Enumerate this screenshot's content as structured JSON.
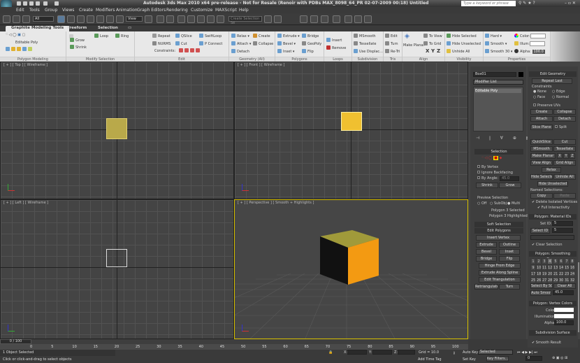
{
  "title": "Autodesk 3ds Max  2010 x64 pre-release - Not for Resale (Renoir with PDBs MAX_8098_64_PR 02-07-2009 00:18)   Untitled",
  "search_placeholder": "Type a keyword or phrase",
  "menu": [
    "Edit",
    "Tools",
    "Group",
    "Views",
    "Create",
    "Modifiers",
    "Animation",
    "Graph Editors",
    "Rendering",
    "Customize",
    "MAXScript",
    "Help"
  ],
  "toolbar": {
    "selection_filter": "All",
    "ref_coord": "View",
    "named_selection_placeholder": "Create Selection Se"
  },
  "ribbon": {
    "tabs": [
      "Graphite Modeling Tools",
      "Freeform",
      "Selection"
    ],
    "panels": {
      "polygon_modeling": {
        "title": "Polygon Modeling",
        "mode": "Editable Poly"
      },
      "modify_selection": {
        "title": "Modify Selection",
        "items": [
          "Grow",
          "Shrink",
          "Loop",
          "Ring"
        ]
      },
      "edit": {
        "title": "Edit",
        "items": [
          "Repeat",
          "QSlice",
          "SwiftLoop",
          "NURMS",
          "Cut",
          "P Connect"
        ],
        "constraints": "Constraints:"
      },
      "geometry": {
        "title": "Geometry (All)",
        "items": [
          "Relax",
          "Create",
          "Attach",
          "Collapse",
          "Detach"
        ]
      },
      "polygons": {
        "title": "Polygons",
        "items": [
          "Extrude",
          "Bridge",
          "Bevel",
          "GeoPoly",
          "Inset",
          "Flip"
        ]
      },
      "loops": {
        "title": "Loops",
        "items": [
          "Insert",
          "Remove"
        ]
      },
      "subdivision": {
        "title": "Subdivision",
        "items": [
          "MSmooth",
          "Tessellate",
          "Use Displac..."
        ]
      },
      "tris": {
        "title": "Tris",
        "items": [
          "Edit",
          "Turn",
          "Re-Tri"
        ]
      },
      "align": {
        "title": "Align",
        "items": [
          "Make Planar",
          "To View",
          "To Grid",
          "X",
          "Y",
          "Z"
        ]
      },
      "visibility": {
        "title": "Visibility",
        "items": [
          "Hide Selected",
          "Hide Unselected",
          "Unhide All"
        ]
      },
      "properties": {
        "title": "Properties",
        "items": [
          "Hard",
          "Smooth",
          "Smooth 30",
          "Color:",
          "Illum:",
          "Alpha:"
        ],
        "alpha": "100.0"
      }
    }
  },
  "viewports": {
    "top": "[ + ] [ Top ] [ Wireframe ]",
    "front": "[ + ] [ Front ] [ Wireframe ]",
    "left": "[ + ] [ Left ] [ Wireframe ]",
    "perspective": "[ + ] [ Perspective ] [ Smooth + Highlights ]"
  },
  "colors": {
    "object": "#e8a020",
    "object_top": "#c8b23a",
    "selected_face": "#f39a12",
    "accent": "#f0d000"
  },
  "command_panel": {
    "object_name": "Box01",
    "modifier_list": "Modifier List",
    "stack_item": "Editable Poly",
    "selection": {
      "title": "Selection",
      "by_vertex": "By Vertex",
      "ignore_backfacing": "Ignore Backfacing",
      "by_angle": "By Angle:",
      "angle": "45.0",
      "shrink": "Shrink",
      "grow": "Grow",
      "preview": "Preview Selection",
      "off": "Off",
      "subobj": "SubObj",
      "multi": "Multi",
      "status1": "Polygon 3 Selected",
      "status2": "Polygon 3 Highlighted"
    },
    "soft_selection": "Soft Selection",
    "edit_polygons": {
      "title": "Edit Polygons",
      "insert_vertex": "Insert Vertex",
      "extrude": "Extrude",
      "outline": "Outline",
      "bevel": "Bevel",
      "inset": "Inset",
      "bridge": "Bridge",
      "flip": "Flip",
      "hinge": "Hinge From Edge",
      "extrude_spline": "Extrude Along Spline",
      "edit_tri": "Edit Triangulation",
      "retriangulate": "Retriangulate",
      "turn": "Turn"
    },
    "edit_geometry": {
      "title": "Edit Geometry",
      "repeat_last": "Repeat Last",
      "constraints": "Constraints",
      "none": "None",
      "edge": "Edge",
      "face": "Face",
      "normal": "Normal",
      "preserve_uvs": "Preserve UVs",
      "create": "Create",
      "collapse": "Collapse",
      "attach": "Attach",
      "detach": "Detach",
      "slice_plane": "Slice Plane",
      "split": "Split",
      "quickslice": "QuickSlice",
      "cut": "Cut",
      "msmooth": "MSmooth",
      "tessellate": "Tessellate",
      "make_planar": "Make Planar",
      "x": "X",
      "y": "Y",
      "z": "Z",
      "view_align": "View Align",
      "grid_align": "Grid Align",
      "relax": "Relax",
      "hide_selected": "Hide Selected",
      "unhide_all": "Unhide All",
      "hide_unselected": "Hide Unselected",
      "named_selections": "Named Selections:",
      "copy": "Copy",
      "paste": "Paste",
      "delete_isolated": "Delete Isolated Vertices",
      "full_interactivity": "Full Interactivity"
    },
    "material_ids": {
      "title": "Polygon: Material IDs",
      "set_id": "Set ID:",
      "set_id_value": "5",
      "select_id": "Select ID",
      "select_id_value": "5",
      "clear_selection": "Clear Selection"
    },
    "smoothing_groups": {
      "title": "Polygon: Smoothing Groups",
      "groups": [
        "1",
        "2",
        "3",
        "4",
        "5",
        "6",
        "7",
        "8",
        "9",
        "10",
        "11",
        "12",
        "13",
        "14",
        "15",
        "16",
        "17",
        "18",
        "19",
        "20",
        "21",
        "22",
        "23",
        "24",
        "25",
        "26",
        "27",
        "28",
        "29",
        "30",
        "31",
        "32"
      ],
      "active": [
        "4"
      ],
      "select_by_sg": "Select By SG",
      "clear_all": "Clear All",
      "auto_smooth": "Auto Smooth",
      "auto_smooth_value": "45.0"
    },
    "vertex_colors": {
      "title": "Polygon: Vertex Colors",
      "color": "Color:",
      "illumination": "Illumination:",
      "alpha": "Alpha:",
      "alpha_value": "100.0"
    },
    "subdivision_surface": {
      "title": "Subdivision Surface",
      "smooth_result": "Smooth Result"
    }
  },
  "timeline": {
    "frame": "0 / 100",
    "ticks": [
      "0",
      "5",
      "10",
      "15",
      "20",
      "25",
      "30",
      "35",
      "40",
      "45",
      "50",
      "55",
      "60",
      "65",
      "70",
      "75",
      "80",
      "85",
      "90",
      "95",
      "100"
    ]
  },
  "status": {
    "selected": "1 Object Selected",
    "prompt": "Click or click-and-drag to select objects",
    "x_label": "X:",
    "y_label": "Y:",
    "z_label": "Z:",
    "grid": "Grid = 10.0",
    "add_time_tag": "Add Time Tag",
    "auto_key": "Auto Key",
    "set_key": "Set Key",
    "key_mode": "Selected",
    "key_filters": "Key Filters...",
    "current_frame": "0"
  }
}
